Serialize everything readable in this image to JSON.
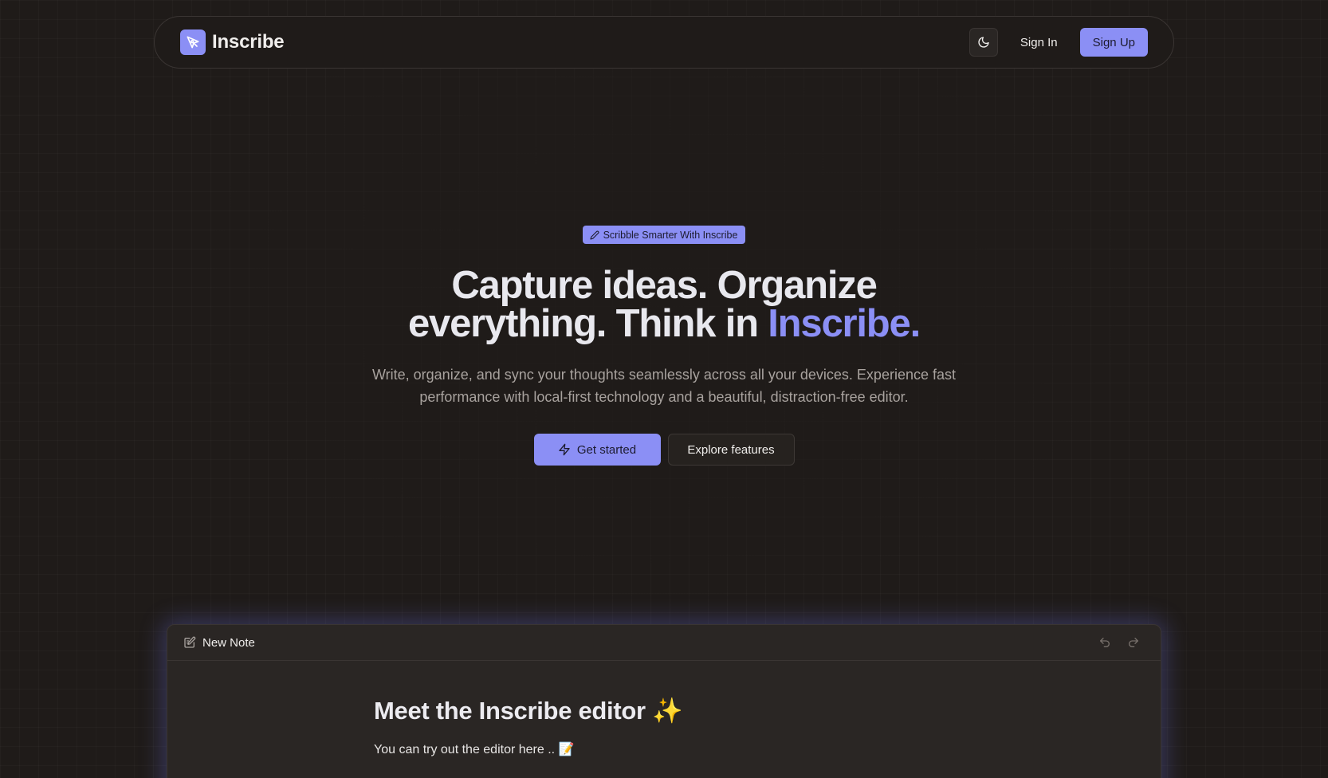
{
  "nav": {
    "brand": "Inscribe",
    "theme_icon": "moon-icon",
    "signin_label": "Sign In",
    "signup_label": "Sign Up"
  },
  "hero": {
    "badge_icon": "pencil-icon",
    "badge_text": "Scribble Smarter With Inscribe",
    "headline_line1": "Capture ideas. Organize",
    "headline_line2_prefix": "everything. Think in ",
    "headline_accent": "Inscribe.",
    "subtext": "Write, organize, and sync your thoughts seamlessly across all your devices. Experience fast performance with local-first technology and a beautiful, distraction-free editor.",
    "primary_cta_icon": "zap-icon",
    "primary_cta": "Get started",
    "secondary_cta": "Explore features"
  },
  "editor": {
    "title_icon": "edit-note-icon",
    "title": "New Note",
    "undo_icon": "undo-icon",
    "redo_icon": "redo-icon",
    "heading": "Meet the Inscribe editor ✨",
    "paragraph": "You can try out the editor here .. 📝"
  },
  "colors": {
    "background": "#1f1b19",
    "accent": "#8b8ff5",
    "text_muted": "#a8a29e",
    "border": "#3a3533"
  }
}
